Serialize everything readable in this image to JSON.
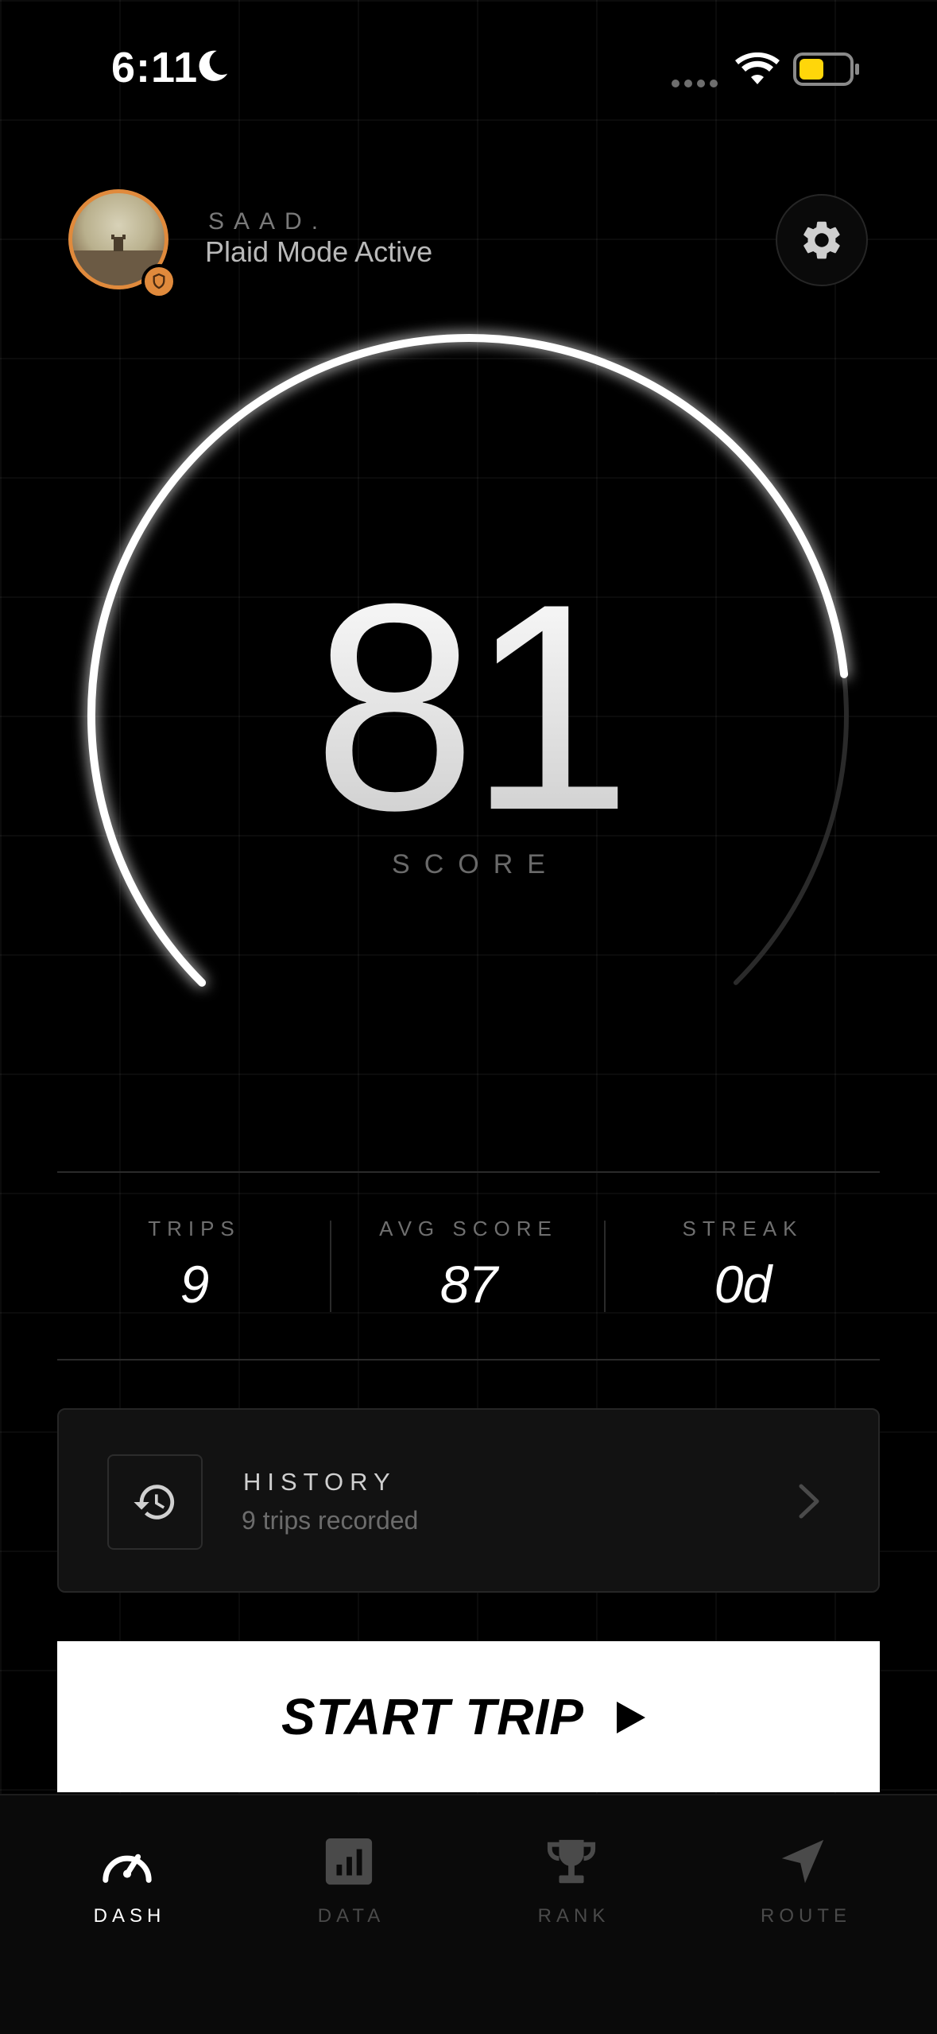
{
  "status_bar": {
    "time": "6:11"
  },
  "header": {
    "user_name": "SAAD.",
    "mode_status": "Plaid Mode Active"
  },
  "score": {
    "value": "81",
    "label": "SCORE",
    "arc_fill": 0.81
  },
  "stats": [
    {
      "label": "TRIPS",
      "value": "9"
    },
    {
      "label": "AVG SCORE",
      "value": "87"
    },
    {
      "label": "STREAK",
      "value": "0d"
    }
  ],
  "history": {
    "title": "HISTORY",
    "subtitle": "9 trips recorded"
  },
  "start_trip": {
    "label": "START TRIP"
  },
  "tabs": [
    {
      "label": "DASH",
      "icon": "speedometer-icon",
      "active": true
    },
    {
      "label": "DATA",
      "icon": "bar-chart-icon",
      "active": false
    },
    {
      "label": "RANK",
      "icon": "trophy-icon",
      "active": false
    },
    {
      "label": "ROUTE",
      "icon": "navigation-arrow-icon",
      "active": false
    }
  ],
  "colors": {
    "accent": "#e08a3c",
    "battery": "#ffd60a",
    "background": "#000000"
  }
}
